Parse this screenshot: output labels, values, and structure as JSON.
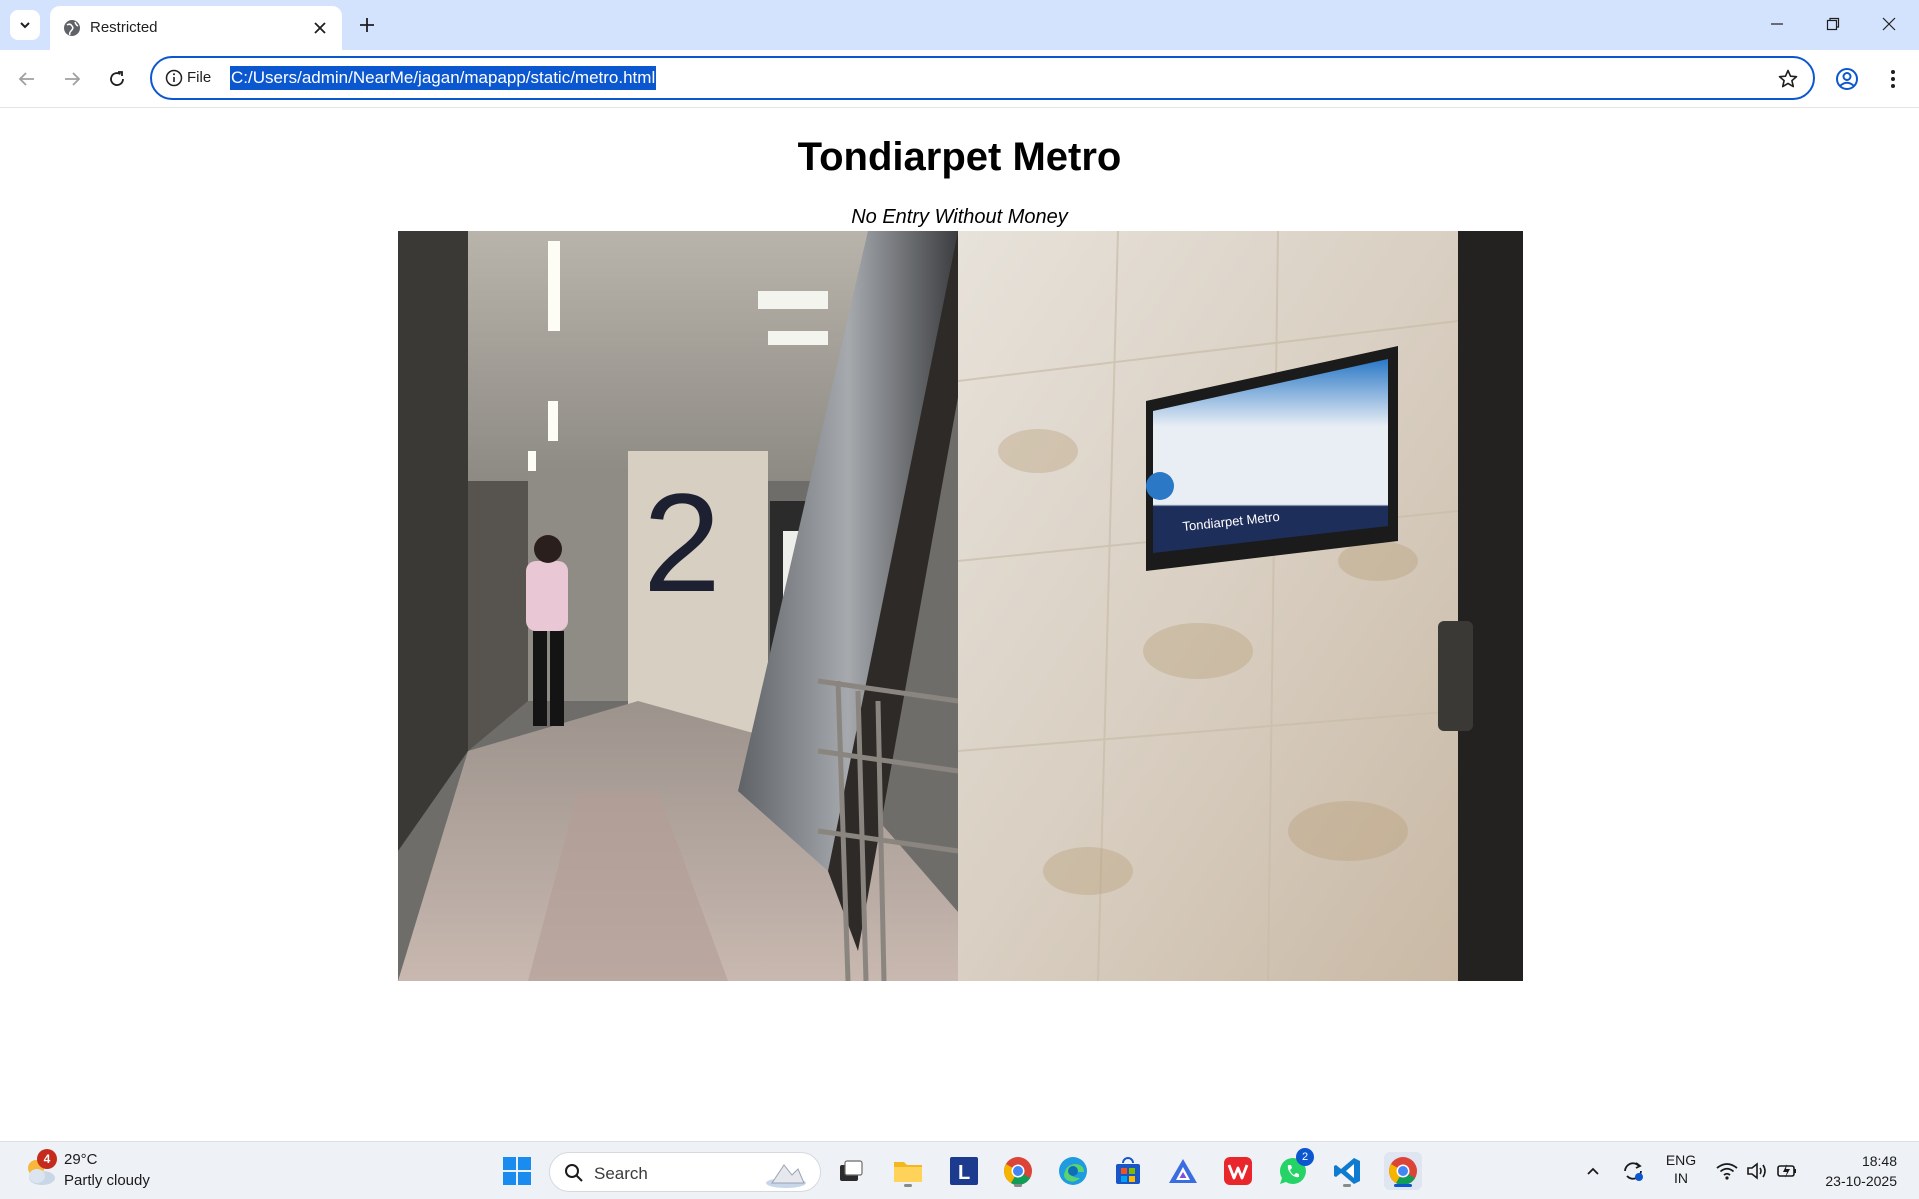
{
  "browser": {
    "tab": {
      "title": "Restricted"
    },
    "omnibox": {
      "scheme_label": "File",
      "url": "C:/Users/admin/NearMe/jagan/mapapp/static/metro.html"
    }
  },
  "page": {
    "heading": "Tondiarpet Metro",
    "subtitle": "No Entry Without Money",
    "image": {
      "sign_text": "Tondiarpet Metro",
      "platform_number": "2"
    }
  },
  "taskbar": {
    "weather": {
      "temperature": "29°C",
      "condition": "Partly cloudy",
      "badge": "4"
    },
    "search_label": "Search",
    "apps": [
      {
        "name": "Task View"
      },
      {
        "name": "File Explorer"
      },
      {
        "name": "L",
        "letter": "L"
      },
      {
        "name": "Google Chrome"
      },
      {
        "name": "Microsoft Edge"
      },
      {
        "name": "Microsoft Store"
      },
      {
        "name": "App"
      },
      {
        "name": "WPS Office"
      },
      {
        "name": "WhatsApp",
        "badge": "2"
      },
      {
        "name": "Visual Studio Code"
      },
      {
        "name": "Google Chrome (active)"
      }
    ],
    "tray": {
      "language_line1": "ENG",
      "language_line2": "IN",
      "time": "18:48",
      "date": "23-10-2025"
    }
  },
  "colors": {
    "tabstrip_bg": "#d3e3fd",
    "accent": "#0b57d0",
    "taskbar_bg": "#eef1f6"
  }
}
